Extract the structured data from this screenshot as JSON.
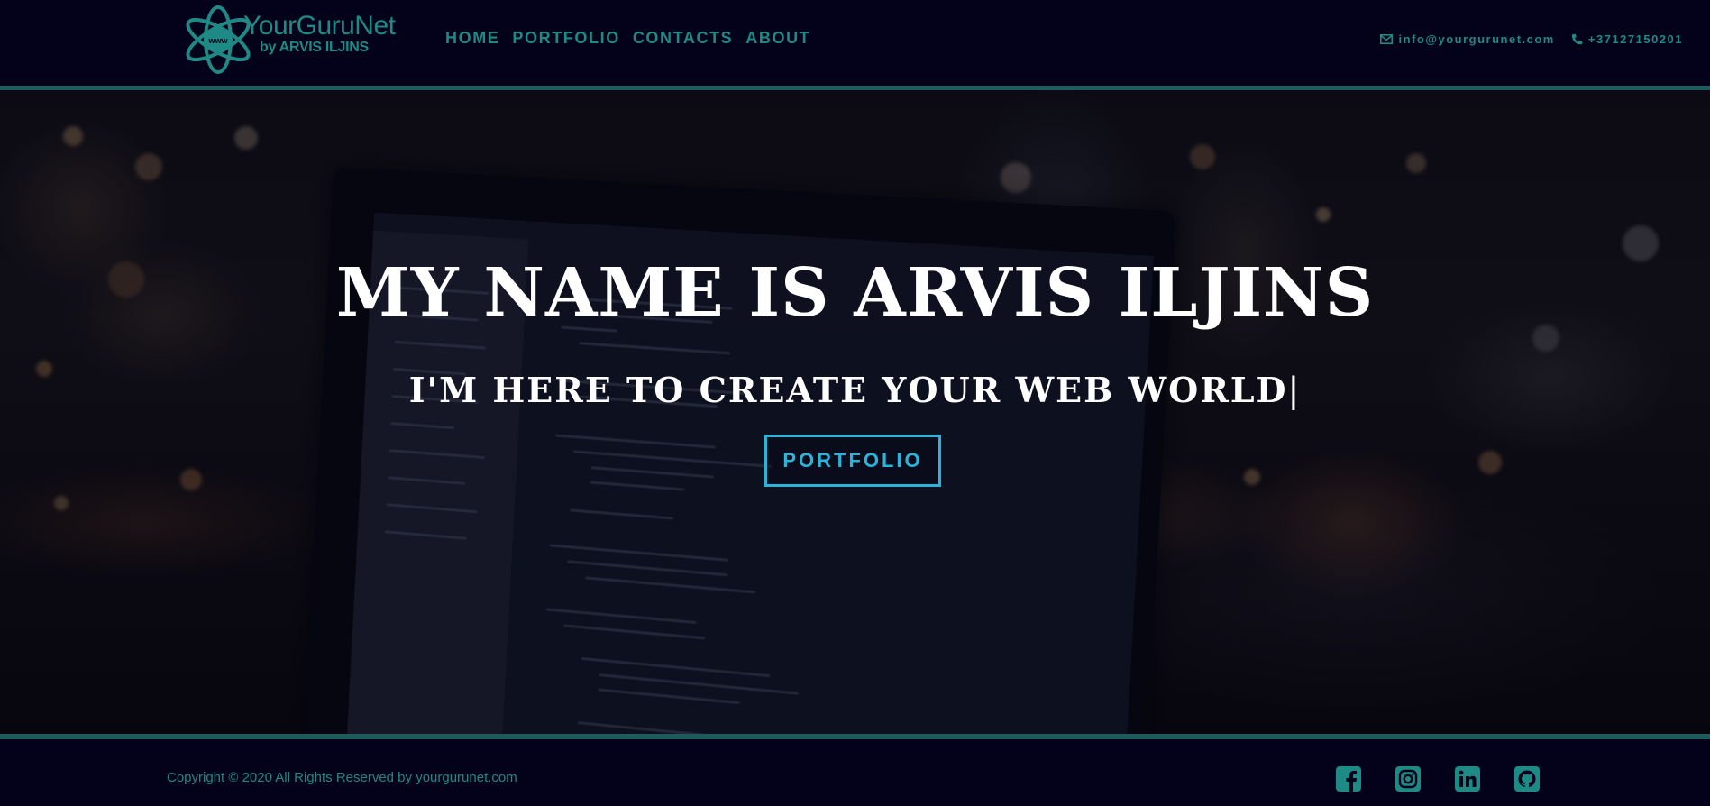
{
  "header": {
    "logo": {
      "title": "YourGuruNet",
      "subtitle": "by ARVIS ILJINS",
      "globe_text": "www"
    },
    "nav": [
      {
        "label": "HOME"
      },
      {
        "label": "PORTFOLIO"
      },
      {
        "label": "CONTACTS"
      },
      {
        "label": "ABOUT"
      }
    ],
    "email": "info@yourgurunet.com",
    "phone": "+37127150201"
  },
  "hero": {
    "title": "MY NAME IS ARVIS ILJINS",
    "subtitle": "I'M HERE TO CREATE YOUR WEB WORLD",
    "cursor": "|",
    "button_label": "PORTFOLIO"
  },
  "footer": {
    "copyright": "Copyright © 2020 All Rights Reserved by yourgurunet.com",
    "socials": [
      "facebook-icon",
      "instagram-icon",
      "linkedin-icon",
      "github-icon"
    ]
  },
  "colors": {
    "background": "#04021a",
    "accent": "#1d8a86",
    "button": "#2ab4d9",
    "hero_text": "#ffffff"
  }
}
